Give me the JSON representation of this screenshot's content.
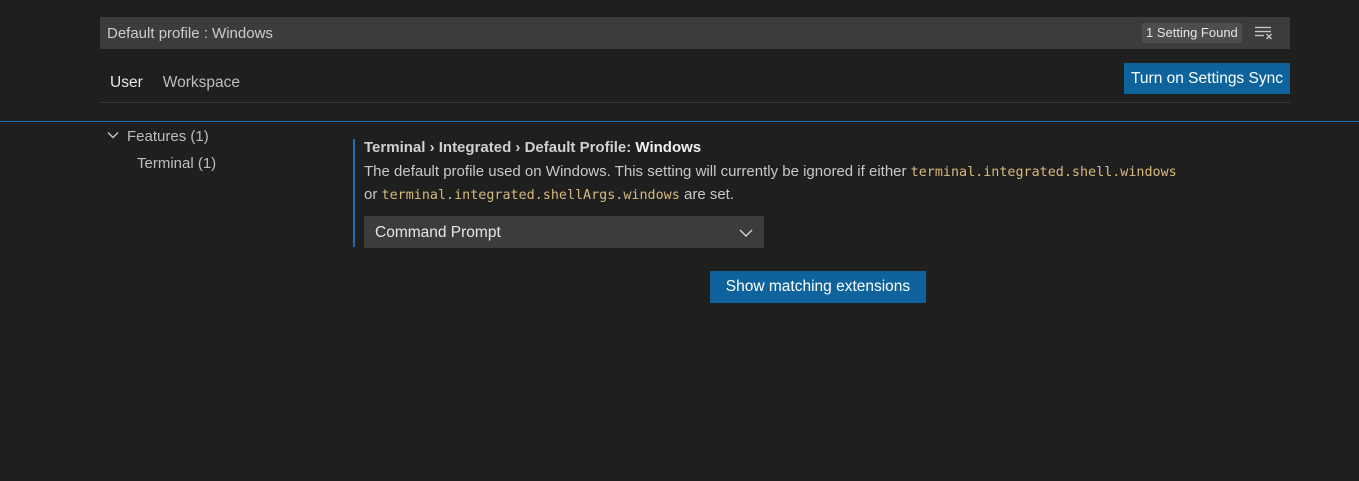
{
  "search": {
    "value": "Default profile : Windows",
    "result_count": "1 Setting Found"
  },
  "tabs": [
    {
      "label": "User",
      "active": true
    },
    {
      "label": "Workspace",
      "active": false
    }
  ],
  "sync_button_label": "Turn on Settings Sync",
  "toc": {
    "features": {
      "label": "Features (1)",
      "expanded": true
    },
    "terminal": {
      "label": "Terminal (1)"
    }
  },
  "setting": {
    "category": "Terminal › Integrated › Default Profile: ",
    "name": "Windows",
    "description_before": "The default profile used on Windows. This setting will currently be ignored if either ",
    "code1": "terminal.integrated.shell.windows",
    "description_middle": " or ",
    "code2": "terminal.integrated.shellArgs.windows",
    "description_after": " are set.",
    "selected_value": "Command Prompt"
  },
  "extensions_button_label": "Show matching extensions",
  "icons": {
    "clear": "clear-filter-icon",
    "chevron_features": "chevron-down-icon",
    "select_chevron": "chevron-down-icon"
  },
  "colors": {
    "background": "#1f1f1f",
    "accent_button": "#0e639c",
    "focus_border": "#1f6fb2",
    "code_text": "#d7ba7d"
  }
}
